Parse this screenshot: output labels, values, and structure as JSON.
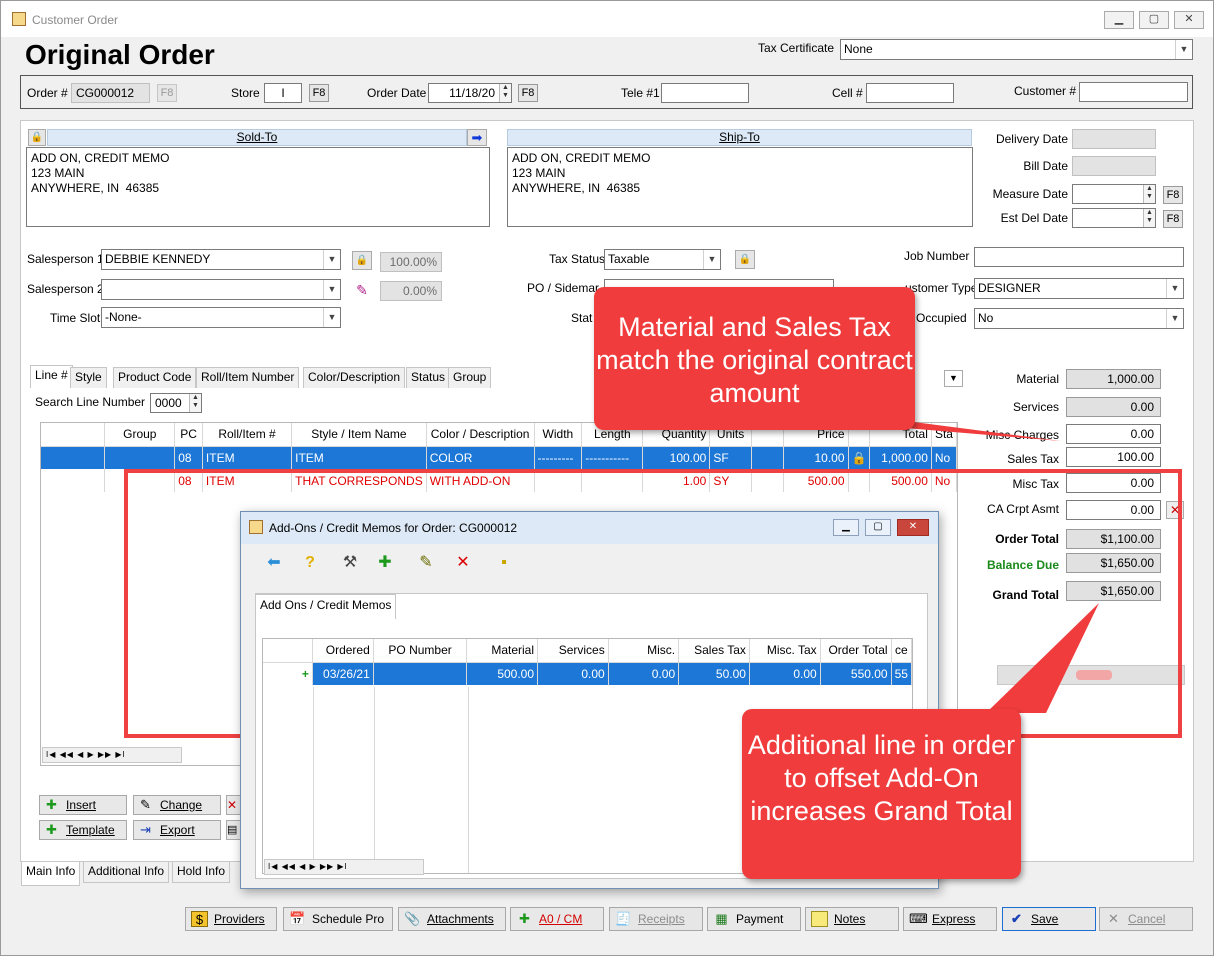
{
  "window": {
    "title": "Customer Order",
    "min": "▁",
    "max": "▢",
    "close": "✕"
  },
  "page_title": "Original Order",
  "tax_certificate": {
    "label": "Tax Certificate",
    "value": "None"
  },
  "order_row": {
    "order_label": "Order #",
    "order_value": "CG000012",
    "f8": "F8",
    "store_label": "Store",
    "store_value": "I",
    "order_date_label": "Order Date",
    "order_date_value": "11/18/20",
    "tele_label": "Tele #1",
    "tele_value": "",
    "cell_label": "Cell #",
    "cell_value": "",
    "customer_label": "Customer #",
    "customer_value": ""
  },
  "sold_to": {
    "header": "Sold-To",
    "address": "ADD ON, CREDIT MEMO\n123 MAIN\nANYWHERE, IN  46385"
  },
  "ship_to": {
    "header": "Ship-To",
    "address": "ADD ON, CREDIT MEMO\n123 MAIN\nANYWHERE, IN  46385"
  },
  "dates": {
    "delivery_label": "Delivery Date",
    "bill_label": "Bill Date",
    "measure_label": "Measure Date",
    "est_del_label": "Est Del Date"
  },
  "salesperson1": {
    "label": "Salesperson 1",
    "value": "DEBBIE KENNEDY",
    "pct": "100.00%"
  },
  "salesperson2": {
    "label": "Salesperson 2",
    "value": "",
    "pct": "0.00%"
  },
  "time_slot": {
    "label": "Time Slot",
    "value": "-None-"
  },
  "tax_status": {
    "label": "Tax Status",
    "value": "Taxable"
  },
  "po_sidemark": {
    "label": "PO / Sidemar"
  },
  "status_label": "Stat",
  "job_number": {
    "label": "Job Number",
    "value": ""
  },
  "customer_type": {
    "label": "ustomer Type",
    "value": "DESIGNER"
  },
  "occupied": {
    "label": "Occupied",
    "value": "No"
  },
  "tabs": [
    "Line #",
    "Style",
    "Product Code",
    "Roll/Item Number",
    "Color/Description",
    "Status",
    "Group"
  ],
  "search_line": {
    "label": "Search Line Number",
    "value": "0000"
  },
  "grid": {
    "headers": [
      "",
      "Group",
      "PC",
      "Roll/Item #",
      "Style / Item Name",
      "Color / Description",
      "Width",
      "Length",
      "Quantity",
      "Units",
      "",
      "Price",
      "",
      "Total",
      "Sta"
    ],
    "rows": [
      [
        "",
        "",
        "08",
        "ITEM",
        "ITEM",
        "COLOR",
        "---------",
        "-----------",
        "100.00",
        "SF",
        "",
        "10.00",
        "🔒",
        "1,000.00",
        "No"
      ],
      [
        "",
        "",
        "08",
        "ITEM",
        "THAT CORRESPONDS",
        "WITH ADD-ON",
        "",
        "",
        "1.00",
        "SY",
        "",
        "500.00",
        "",
        "500.00",
        "No"
      ]
    ]
  },
  "grid_nav": "I◀ ◀◀ ◀ ▶ ▶▶ ▶I",
  "summary": {
    "material_label": "Material",
    "material": "1,000.00",
    "services_label": "Services",
    "services": "0.00",
    "misc_charges_label": "Misc Charges",
    "misc_charges": "0.00",
    "sales_tax_label": "Sales Tax",
    "sales_tax": "100.00",
    "misc_tax_label": "Misc Tax",
    "misc_tax": "0.00",
    "ca_label": "CA Crpt Asmt",
    "ca": "0.00",
    "order_total_label": "Order Total",
    "order_total": "$1,100.00",
    "balance_due_label": "Balance Due",
    "balance_due": "$1,650.00",
    "grand_total_label": "Grand Total",
    "grand_total": "$1,650.00"
  },
  "line_buttons": {
    "insert": "Insert",
    "change": "Change",
    "template": "Template",
    "export": "Export"
  },
  "bottom_tabs": [
    "Main Info",
    "Additional Info",
    "Hold Info"
  ],
  "bottom_buttons": [
    "Providers",
    "Schedule Pro",
    "Attachments",
    "A0 / CM",
    "Receipts",
    "Payment",
    "Notes",
    "Express",
    "Save",
    "Cancel"
  ],
  "popup": {
    "title": "Add-Ons / Credit Memos for Order: CG000012",
    "tab": "Add Ons / Credit Memos",
    "headers": [
      "",
      "Ordered",
      "PO Number",
      "Material",
      "Services",
      "Misc.",
      "Sales Tax",
      "Misc. Tax",
      "Order Total",
      "ce"
    ],
    "rows": [
      [
        "+",
        "03/26/21",
        "",
        "500.00",
        "0.00",
        "0.00",
        "50.00",
        "0.00",
        "550.00",
        "55"
      ]
    ]
  },
  "callouts": {
    "top": "Material and Sales Tax match the original contract amount",
    "bottom": "Additional line in order to offset Add-On increases Grand Total"
  },
  "colors": {
    "callout": "#f03c3c",
    "selection": "#1c77d6",
    "header_blue": "#dde9f6",
    "red_text": "#e00000",
    "balance_green": "#1a8a1a"
  }
}
